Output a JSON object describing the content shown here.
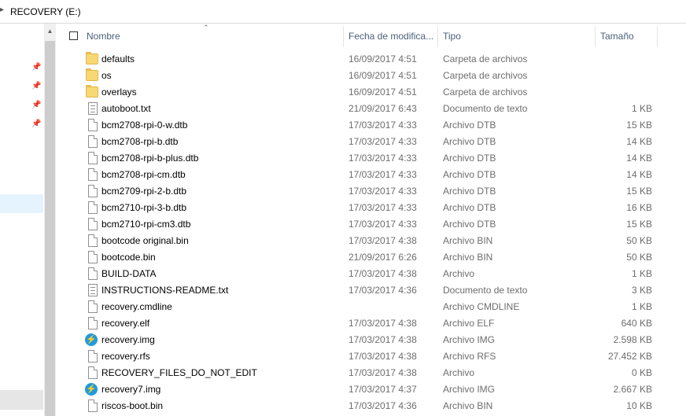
{
  "address": {
    "path": "RECOVERY (E:)",
    "chevron_icon": "chevron-right-icon"
  },
  "header": {
    "name": "Nombre",
    "date": "Fecha de modifica...",
    "type": "Tipo",
    "size": "Tamaño"
  },
  "files": [
    {
      "name": "defaults",
      "date": "16/09/2017 4:51",
      "type": "Carpeta de archivos",
      "size": "",
      "icon": "folder"
    },
    {
      "name": "os",
      "date": "16/09/2017 4:51",
      "type": "Carpeta de archivos",
      "size": "",
      "icon": "folder"
    },
    {
      "name": "overlays",
      "date": "16/09/2017 4:51",
      "type": "Carpeta de archivos",
      "size": "",
      "icon": "folder"
    },
    {
      "name": "autoboot.txt",
      "date": "21/09/2017 6:43",
      "type": "Documento de texto",
      "size": "1 KB",
      "icon": "text"
    },
    {
      "name": "bcm2708-rpi-0-w.dtb",
      "date": "17/03/2017 4:33",
      "type": "Archivo DTB",
      "size": "15 KB",
      "icon": "file"
    },
    {
      "name": "bcm2708-rpi-b.dtb",
      "date": "17/03/2017 4:33",
      "type": "Archivo DTB",
      "size": "14 KB",
      "icon": "file"
    },
    {
      "name": "bcm2708-rpi-b-plus.dtb",
      "date": "17/03/2017 4:33",
      "type": "Archivo DTB",
      "size": "14 KB",
      "icon": "file"
    },
    {
      "name": "bcm2708-rpi-cm.dtb",
      "date": "17/03/2017 4:33",
      "type": "Archivo DTB",
      "size": "14 KB",
      "icon": "file"
    },
    {
      "name": "bcm2709-rpi-2-b.dtb",
      "date": "17/03/2017 4:33",
      "type": "Archivo DTB",
      "size": "15 KB",
      "icon": "file"
    },
    {
      "name": "bcm2710-rpi-3-b.dtb",
      "date": "17/03/2017 4:33",
      "type": "Archivo DTB",
      "size": "16 KB",
      "icon": "file"
    },
    {
      "name": "bcm2710-rpi-cm3.dtb",
      "date": "17/03/2017 4:33",
      "type": "Archivo DTB",
      "size": "15 KB",
      "icon": "file"
    },
    {
      "name": "bootcode original.bin",
      "date": "17/03/2017 4:38",
      "type": "Archivo BIN",
      "size": "50 KB",
      "icon": "file"
    },
    {
      "name": "bootcode.bin",
      "date": "21/09/2017 6:26",
      "type": "Archivo BIN",
      "size": "50 KB",
      "icon": "file"
    },
    {
      "name": "BUILD-DATA",
      "date": "17/03/2017 4:38",
      "type": "Archivo",
      "size": "1 KB",
      "icon": "file"
    },
    {
      "name": "INSTRUCTIONS-README.txt",
      "date": "17/03/2017 4:36",
      "type": "Documento de texto",
      "size": "3 KB",
      "icon": "text"
    },
    {
      "name": "recovery.cmdline",
      "date": "",
      "type": "Archivo CMDLINE",
      "size": "1 KB",
      "icon": "file"
    },
    {
      "name": "recovery.elf",
      "date": "17/03/2017 4:38",
      "type": "Archivo ELF",
      "size": "640 KB",
      "icon": "file"
    },
    {
      "name": "recovery.img",
      "date": "17/03/2017 4:38",
      "type": "Archivo IMG",
      "size": "2.598 KB",
      "icon": "img"
    },
    {
      "name": "recovery.rfs",
      "date": "17/03/2017 4:38",
      "type": "Archivo RFS",
      "size": "27.452 KB",
      "icon": "file"
    },
    {
      "name": "RECOVERY_FILES_DO_NOT_EDIT",
      "date": "17/03/2017 4:38",
      "type": "Archivo",
      "size": "0 KB",
      "icon": "file"
    },
    {
      "name": "recovery7.img",
      "date": "17/03/2017 4:37",
      "type": "Archivo IMG",
      "size": "2.667 KB",
      "icon": "img"
    },
    {
      "name": "riscos-boot.bin",
      "date": "17/03/2017 4:36",
      "type": "Archivo BIN",
      "size": "10 KB",
      "icon": "file"
    }
  ]
}
